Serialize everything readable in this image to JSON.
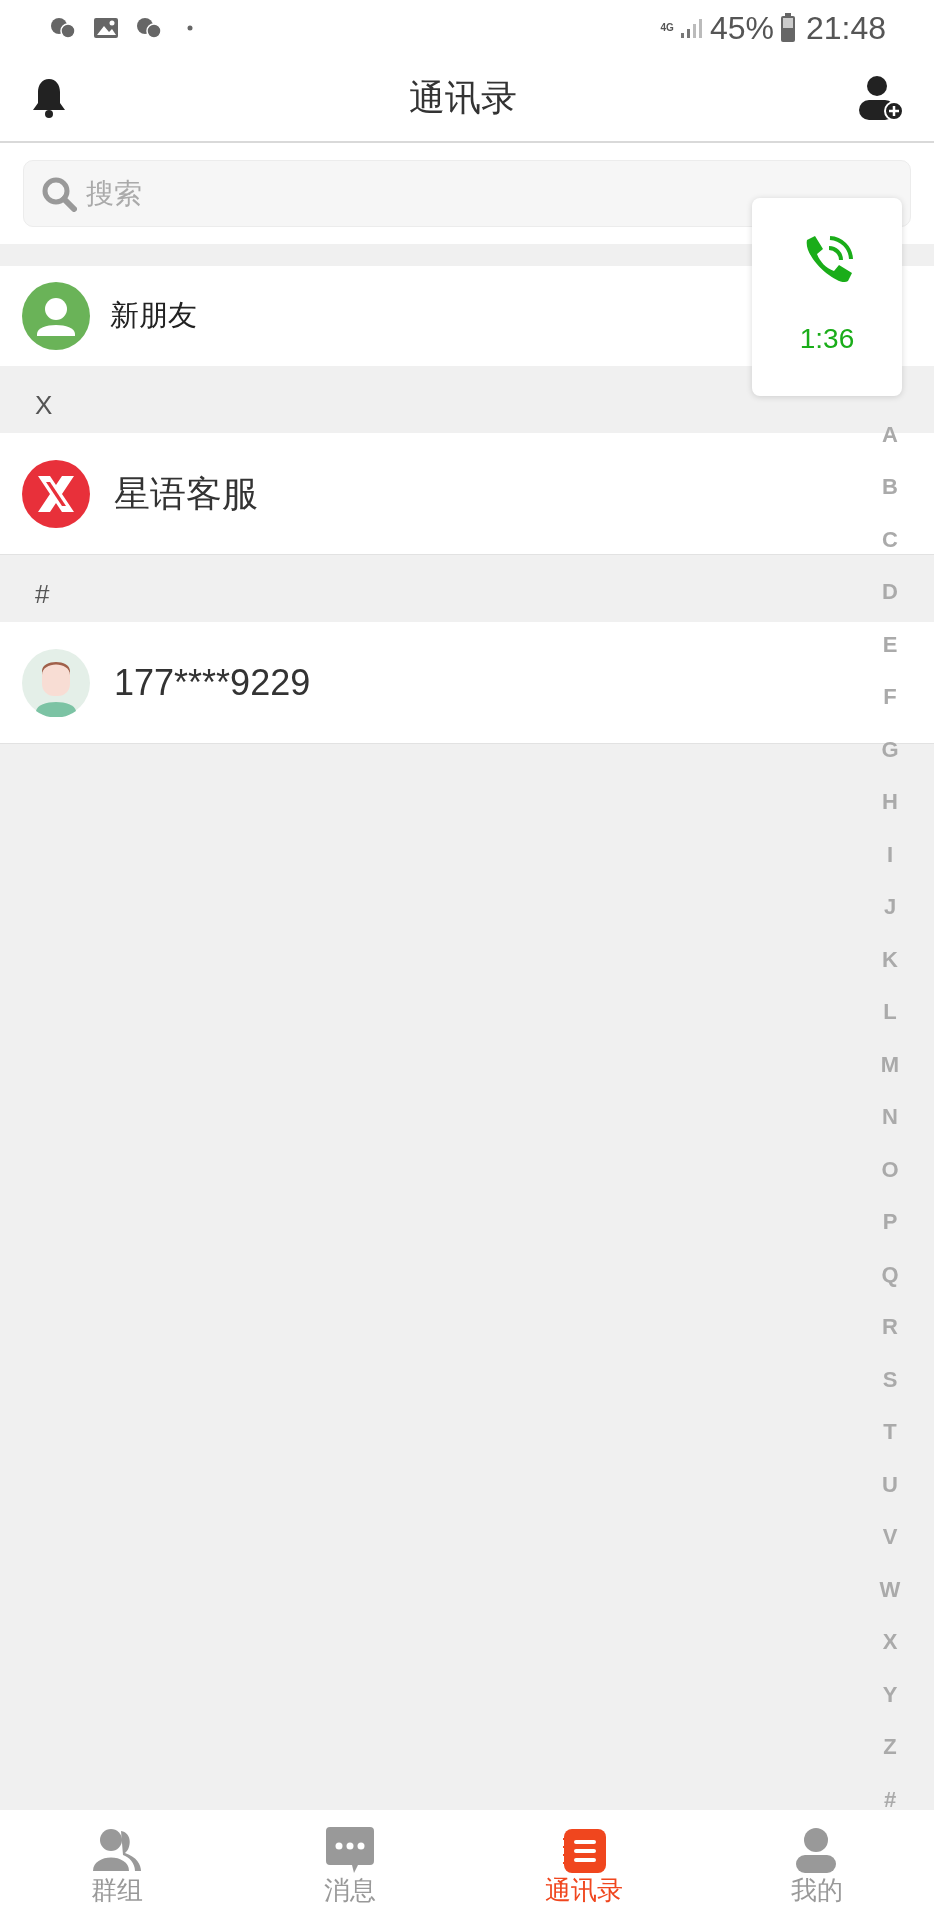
{
  "status_bar": {
    "network": "4G",
    "battery": "45%",
    "time": "21:48"
  },
  "header": {
    "title": "通讯录"
  },
  "search": {
    "placeholder": "搜索"
  },
  "new_friends": {
    "label": "新朋友"
  },
  "sections": [
    {
      "letter": "X",
      "contacts": [
        {
          "name": "星语客服",
          "kind": "brand"
        }
      ]
    },
    {
      "letter": "#",
      "contacts": [
        {
          "name": "177****9229",
          "kind": "person"
        }
      ]
    }
  ],
  "call_float": {
    "duration": "1:36"
  },
  "index_letters": [
    "A",
    "B",
    "C",
    "D",
    "E",
    "F",
    "G",
    "H",
    "I",
    "J",
    "K",
    "L",
    "M",
    "N",
    "O",
    "P",
    "Q",
    "R",
    "S",
    "T",
    "U",
    "V",
    "W",
    "X",
    "Y",
    "Z",
    "#"
  ],
  "tab_bar": [
    {
      "label": "群组",
      "kind": "groups",
      "selected": false
    },
    {
      "label": "消息",
      "kind": "messages",
      "selected": false
    },
    {
      "label": "通讯录",
      "kind": "contacts",
      "selected": true
    },
    {
      "label": "我的",
      "kind": "me",
      "selected": false
    }
  ]
}
